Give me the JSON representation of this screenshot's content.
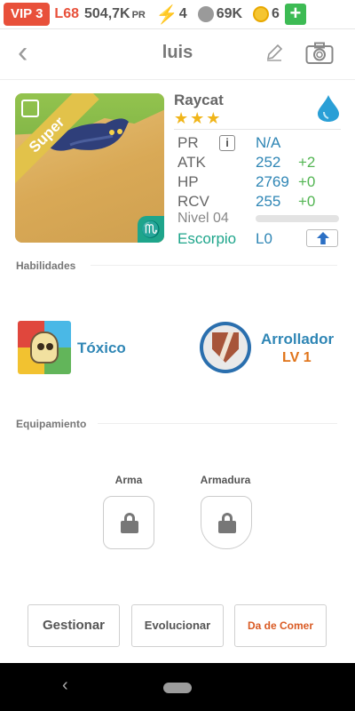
{
  "status": {
    "vip": "VIP 3",
    "level": "L68",
    "pr_value": "504,7K",
    "pr_unit": "PR",
    "energy": "4",
    "paws": "69K",
    "coins": "6",
    "plus": "+"
  },
  "header": {
    "title": "luis",
    "back": "‹"
  },
  "pet": {
    "name": "Raycat",
    "stars": "★★★",
    "badge": "Super",
    "zodiac_symbol": "♏",
    "stats": {
      "pr_label": "PR",
      "pr_value": "N/A",
      "info": "i",
      "atk_label": "ATK",
      "atk_value": "252",
      "atk_inc": "+2",
      "hp_label": "HP",
      "hp_value": "2769",
      "hp_inc": "+0",
      "rcv_label": "RCV",
      "rcv_value": "255",
      "rcv_inc": "+0",
      "level_label": "Nivel 04",
      "level_progress": 0,
      "zodiac_label": "Escorpio",
      "zodiac_level": "L0"
    }
  },
  "sections": {
    "abilities": "Habilidades",
    "equipment": "Equipamiento"
  },
  "skills": [
    {
      "name": "Tóxico"
    },
    {
      "name": "Arrollador",
      "level": "LV 1"
    }
  ],
  "equipment": {
    "weapon": "Arma",
    "armor": "Armadura"
  },
  "actions": {
    "manage": "Gestionar",
    "evolve": "Evolucionar",
    "feed": "Da de Comer"
  },
  "nav": {
    "back": "‹"
  }
}
